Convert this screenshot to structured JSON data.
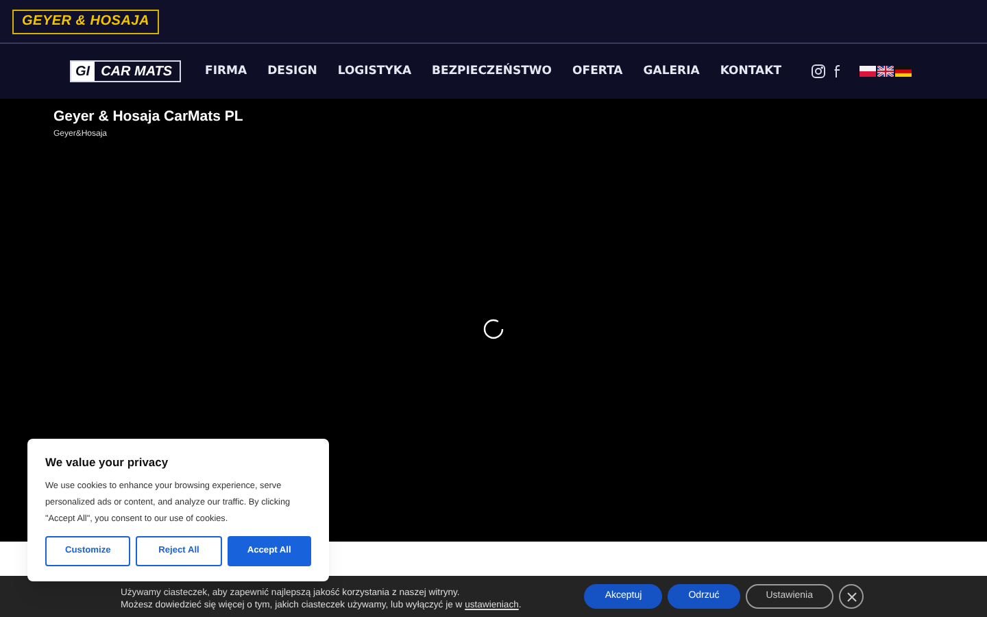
{
  "top_logo": "GEYER & HOSAJA",
  "brand": {
    "mark": "GI",
    "name": "CAR MATS"
  },
  "nav": [
    {
      "label": "FIRMA"
    },
    {
      "label": "DESIGN"
    },
    {
      "label": "LOGISTYKA"
    },
    {
      "label": "BEZPIECZEŃSTWO"
    },
    {
      "label": "OFERTA"
    },
    {
      "label": "GALERIA"
    },
    {
      "label": "KONTAKT"
    }
  ],
  "socials": [
    {
      "kind": "instagram"
    },
    {
      "kind": "facebook"
    }
  ],
  "languages": [
    {
      "kind": "pl"
    },
    {
      "kind": "en"
    },
    {
      "kind": "de"
    }
  ],
  "video": {
    "title": "Geyer & Hosaja CarMats PL",
    "channel": "Geyer&Hosaja"
  },
  "cookie_bar": {
    "line_1": "Używamy ciasteczek, aby zapewnić najlepszą jakość korzystania z naszej witryny.",
    "line_2": "Możesz dowiedzieć się więcej o tym, jakich ciasteczek używamy, lub wyłączyć je w ",
    "link": "ustawieniach",
    "line_2_end": ".",
    "buttons": [
      {
        "label": "Akceptuj",
        "kind": "filled"
      },
      {
        "label": "Odrzuć",
        "kind": "filled"
      },
      {
        "label": "Ustawienia",
        "kind": "outline"
      }
    ]
  },
  "privacy_dialog": {
    "title": "We value your privacy",
    "text": "We use cookies to enhance your browsing experience, serve personalized ads or content, and analyze our traffic. By clicking \"Accept All\", you consent to our use of cookies.",
    "buttons": [
      {
        "label": "Customize",
        "kind": "outline"
      },
      {
        "label": "Reject All",
        "kind": "outline"
      },
      {
        "label": "Accept All",
        "kind": "filled"
      }
    ]
  }
}
